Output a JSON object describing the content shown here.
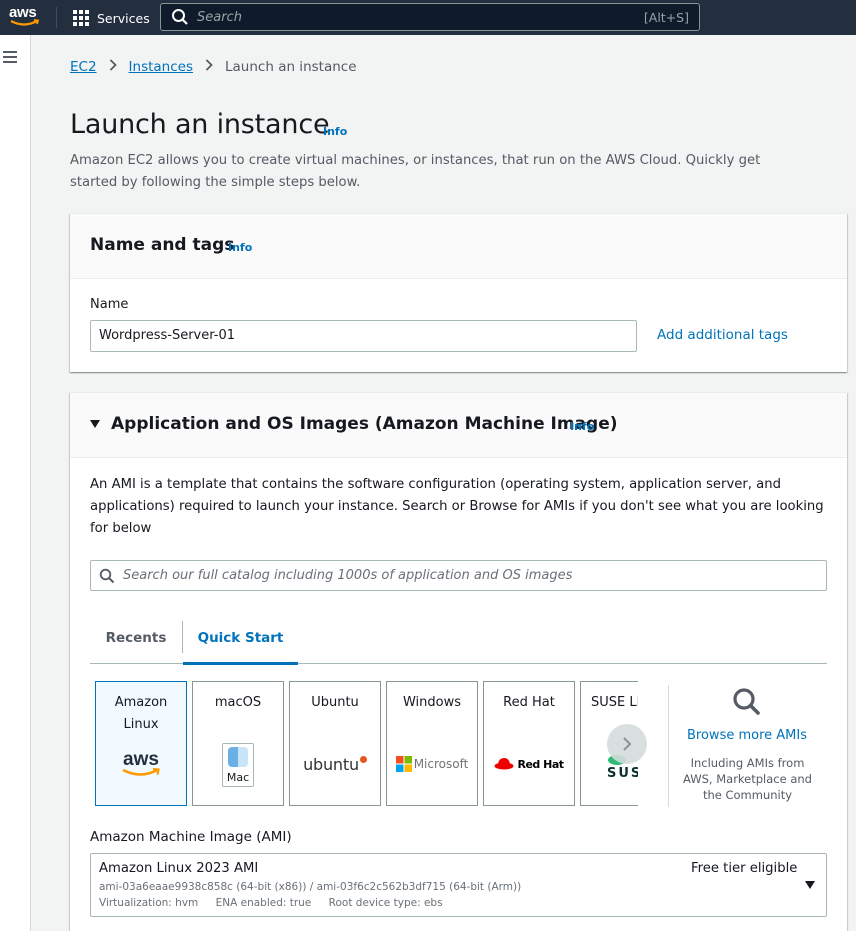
{
  "topnav": {
    "logo_text": "aws",
    "services_label": "Services",
    "search_placeholder": "Search",
    "search_shortcut": "[Alt+S]"
  },
  "breadcrumb": {
    "items": [
      "EC2",
      "Instances"
    ],
    "current": "Launch an instance"
  },
  "page": {
    "title": "Launch an instance",
    "info": "Info",
    "description": "Amazon EC2 allows you to create virtual machines, or instances, that run on the AWS Cloud. Quickly get started by following the simple steps below."
  },
  "name_tags": {
    "title": "Name and tags",
    "info": "Info",
    "name_label": "Name",
    "name_value": "Wordpress-Server-01",
    "add_tags": "Add additional tags"
  },
  "ami_panel": {
    "title": "Application and OS Images (Amazon Machine Image)",
    "info": "Info",
    "description": "An AMI is a template that contains the software configuration (operating system, application server, and applications) required to launch your instance. Search or Browse for AMIs if you don't see what you are looking for below",
    "search_placeholder": "Search our full catalog including 1000s of application and OS images",
    "tabs": [
      "Recents",
      "Quick Start"
    ],
    "tiles": [
      {
        "name": "Amazon Linux",
        "logo": "aws-logo",
        "logo_text": "aws",
        "selected": true
      },
      {
        "name": "macOS",
        "logo": "mac-logo",
        "logo_text": "Mac"
      },
      {
        "name": "Ubuntu",
        "logo": "ubuntu-logo",
        "logo_text": "ubuntu"
      },
      {
        "name": "Windows",
        "logo": "microsoft-logo",
        "logo_text": "Microsoft"
      },
      {
        "name": "Red Hat",
        "logo": "redhat-logo",
        "logo_text": "Red Hat"
      },
      {
        "name": "SUSE Li",
        "logo": "suse-logo",
        "logo_text": "SUS"
      }
    ],
    "browse_link": "Browse more AMIs",
    "browse_sub": "Including AMIs from AWS, Marketplace and the Community",
    "ami_label": "Amazon Machine Image (AMI)",
    "selected_ami": {
      "name": "Amazon Linux 2023 AMI",
      "ids": "ami-03a6eaae9938c858c (64-bit (x86)) / ami-03f6c2c562b3df715 (64-bit (Arm))",
      "virtualization": "Virtualization: hvm",
      "ena": "ENA enabled: true",
      "root_device": "Root device type: ebs",
      "badge": "Free tier eligible"
    }
  },
  "colors": {
    "nav_bg": "#232f3e",
    "link": "#0073bb",
    "aws_orange": "#ff9900",
    "page_bg": "#f2f3f3"
  }
}
